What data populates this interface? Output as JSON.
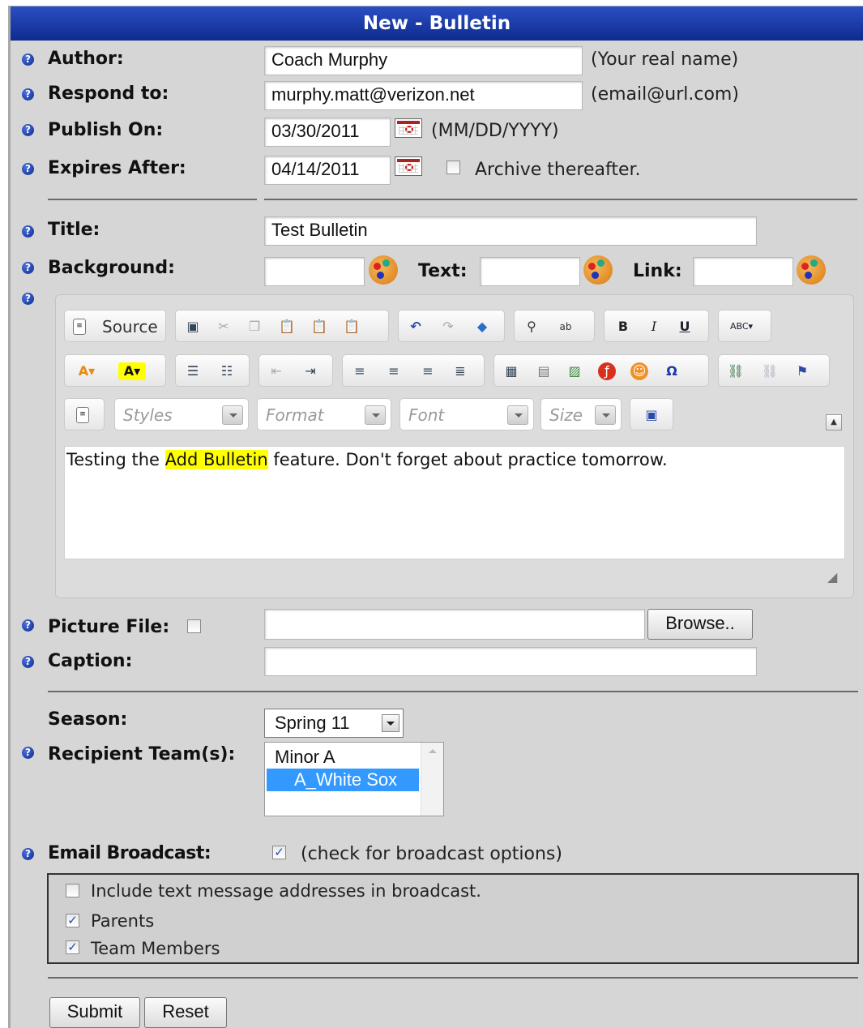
{
  "title": "New - Bulletin",
  "fields": {
    "author": {
      "label": "Author:",
      "value": "Coach Murphy",
      "hint": "(Your real name)"
    },
    "respond_to": {
      "label": "Respond to:",
      "value": "murphy.matt@verizon.net",
      "hint": "(email@url.com)"
    },
    "publish_on": {
      "label": "Publish On:",
      "value": "03/30/2011",
      "hint": "(MM/DD/YYYY)"
    },
    "expires_after": {
      "label": "Expires After:",
      "value": "04/14/2011",
      "archive_label": "Archive thereafter.",
      "archive_checked": false
    },
    "title": {
      "label": "Title:",
      "value": "Test Bulletin"
    },
    "background": {
      "label": "Background:",
      "value": ""
    },
    "text_color": {
      "label": "Text:",
      "value": ""
    },
    "link_color": {
      "label": "Link:",
      "value": ""
    },
    "picture_file": {
      "label": "Picture File:",
      "value": "",
      "browse_label": "Browse..",
      "checked": false
    },
    "caption": {
      "label": "Caption:",
      "value": ""
    },
    "season": {
      "label": "Season:",
      "value": "Spring 11"
    },
    "recipient_teams": {
      "label": "Recipient Team(s):",
      "options": [
        "Minor A",
        "A_White Sox"
      ],
      "selected": "A_White Sox"
    },
    "email_broadcast": {
      "label": "Email Broadcast:",
      "hint": "(check for broadcast options)",
      "checked": true
    }
  },
  "editor": {
    "source_label": "Source",
    "combos": {
      "styles": "Styles",
      "format": "Format",
      "font": "Font",
      "size": "Size"
    },
    "content_before": "Testing the ",
    "content_highlight": "Add Bulletin",
    "content_after": " feature. Don't forget about practice tomorrow."
  },
  "broadcast_options": [
    {
      "label": "Include text message addresses in broadcast.",
      "checked": false
    },
    {
      "label": "Parents",
      "checked": true
    },
    {
      "label": "Team Members",
      "checked": true
    }
  ],
  "buttons": {
    "submit": "Submit",
    "reset": "Reset"
  },
  "colors": {
    "title_bar": "#1a3aa8",
    "highlight": "#ffff00",
    "selection": "#3399ff",
    "panel": "#d6d6d6"
  }
}
